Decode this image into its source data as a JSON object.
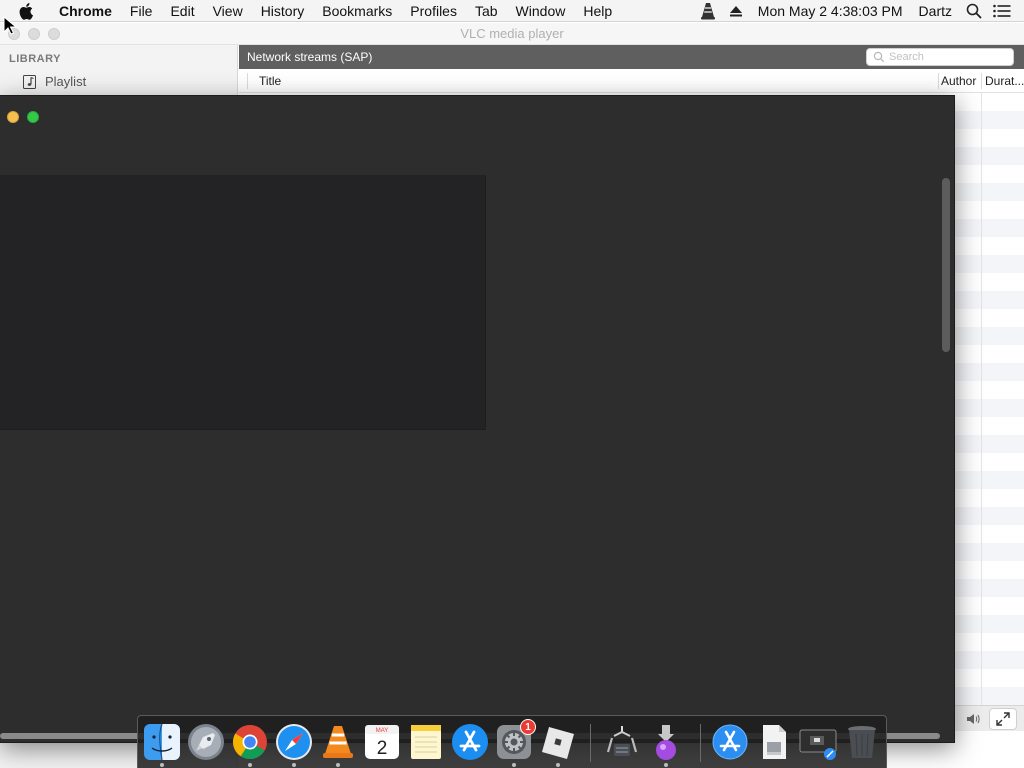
{
  "menubar": {
    "app_name": "Chrome",
    "menus": [
      "File",
      "Edit",
      "View",
      "History",
      "Bookmarks",
      "Profiles",
      "Tab",
      "Window",
      "Help"
    ],
    "status_icons": [
      "vlc-cone-icon",
      "eject-icon"
    ],
    "datetime": "Mon May 2  4:38:03 PM",
    "user": "Dartz"
  },
  "vlc": {
    "window_title": "VLC media player",
    "sidebar": {
      "section_title": "LIBRARY",
      "items": [
        {
          "label": "Playlist",
          "icon": "playlist-icon"
        }
      ]
    },
    "header_title": "Network streams (SAP)",
    "search_placeholder": "Search",
    "columns": [
      "Title",
      "Author",
      "Durat..."
    ]
  },
  "dock": {
    "items": [
      {
        "name": "finder",
        "running": true
      },
      {
        "name": "launchpad",
        "running": false
      },
      {
        "name": "chrome",
        "running": true
      },
      {
        "name": "safari",
        "running": true
      },
      {
        "name": "vlc",
        "running": true
      },
      {
        "name": "calendar",
        "running": false,
        "month": "MAY",
        "day": "2"
      },
      {
        "name": "notes",
        "running": false
      },
      {
        "name": "app-store",
        "running": false
      },
      {
        "name": "system-preferences",
        "running": true,
        "badge": "1"
      },
      {
        "name": "roblox",
        "running": true
      },
      {
        "name": "scanner-utility",
        "running": false
      },
      {
        "name": "installer",
        "running": true
      },
      {
        "name": "app-store-folder",
        "running": false
      },
      {
        "name": "document",
        "running": false
      },
      {
        "name": "screenshot",
        "running": false
      },
      {
        "name": "trash",
        "running": false
      }
    ]
  },
  "colors": {
    "dark_window": "#2d2d2d",
    "video_area": "#232325",
    "minimize_light": "#f5bf4f",
    "zoom_light": "#36c84a",
    "vlc_header": "#5f5f5f"
  }
}
